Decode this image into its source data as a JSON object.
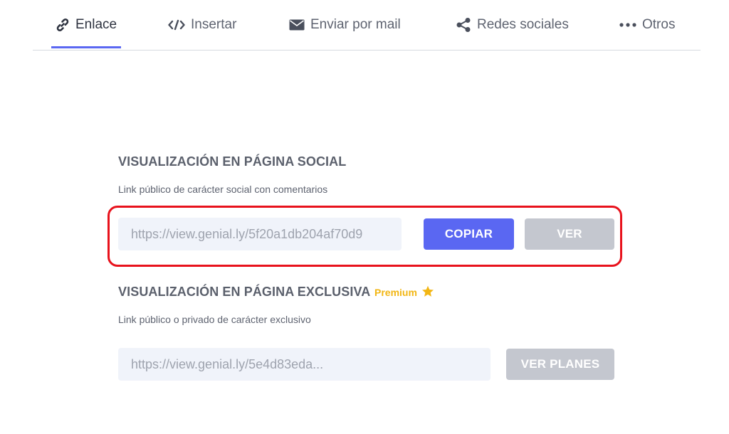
{
  "tabs": [
    {
      "label": "Enlace",
      "icon": "link-icon",
      "active": true
    },
    {
      "label": "Insertar",
      "icon": "code-icon",
      "active": false
    },
    {
      "label": "Enviar por mail",
      "icon": "envelope-icon",
      "active": false
    },
    {
      "label": "Redes sociales",
      "icon": "share-icon",
      "active": false
    },
    {
      "label": "Otros",
      "icon": "more-icon",
      "active": false
    }
  ],
  "social": {
    "title": "VISUALIZACIÓN EN PÁGINA SOCIAL",
    "subtitle": "Link público de carácter social con comentarios",
    "url": "https://view.genial.ly/5f20a1db204af70d9",
    "copy_label": "COPIAR",
    "view_label": "VER"
  },
  "exclusive": {
    "title": "VISUALIZACIÓN EN PÁGINA EXCLUSIVA",
    "badge": "Premium",
    "subtitle": "Link público o privado de carácter exclusivo",
    "url": "https://view.genial.ly/5e4d83eda...",
    "plans_label": "VER PLANES"
  },
  "colors": {
    "accent": "#5a67f2",
    "disabled": "#c4c7cf",
    "premium": "#f2b614",
    "highlight": "#e8121c"
  }
}
